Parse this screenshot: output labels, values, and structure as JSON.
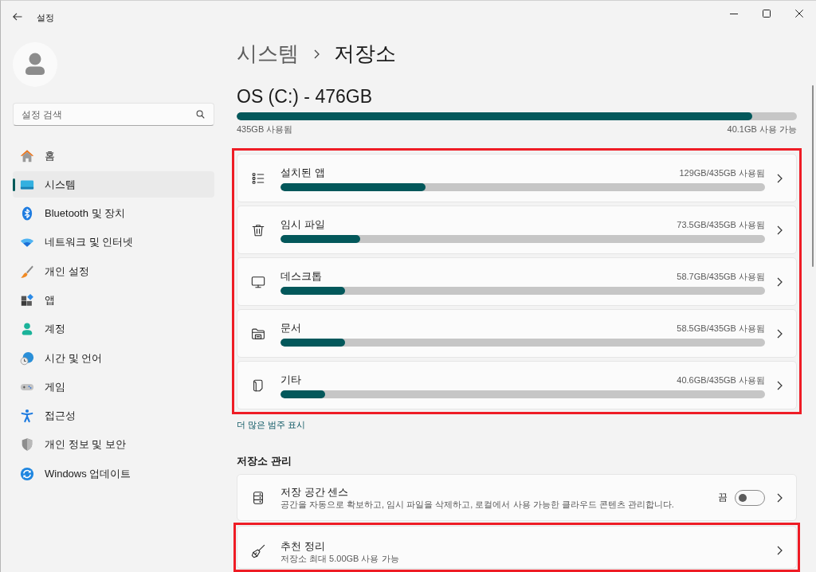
{
  "window": {
    "title": "설정"
  },
  "sidebar": {
    "search": {
      "placeholder": "설정 검색"
    },
    "items": [
      {
        "label": "홈",
        "selected": false
      },
      {
        "label": "시스템",
        "selected": true
      },
      {
        "label": "Bluetooth 및 장치",
        "selected": false
      },
      {
        "label": "네트워크 및 인터넷",
        "selected": false
      },
      {
        "label": "개인 설정",
        "selected": false
      },
      {
        "label": "앱",
        "selected": false
      },
      {
        "label": "계정",
        "selected": false
      },
      {
        "label": "시간 및 언어",
        "selected": false
      },
      {
        "label": "게임",
        "selected": false
      },
      {
        "label": "접근성",
        "selected": false
      },
      {
        "label": "개인 정보 및 보안",
        "selected": false
      },
      {
        "label": "Windows 업데이트",
        "selected": false
      }
    ]
  },
  "breadcrumb": [
    "시스템",
    "저장소"
  ],
  "drive": {
    "title": "OS (C:) - 476GB",
    "level": 0.92,
    "used": "435GB 사용됨",
    "available": "40.1GB 사용 가능"
  },
  "categories": {
    "highlighted": true,
    "items": [
      {
        "label": "설치된 앱",
        "usage": "129GB/435GB 사용됨",
        "level": 0.3
      },
      {
        "label": "임시 파일",
        "usage": "73.5GB/435GB 사용됨",
        "level": 0.165
      },
      {
        "label": "데스크톱",
        "usage": "58.7GB/435GB 사용됨",
        "level": 0.134
      },
      {
        "label": "문서",
        "usage": "58.5GB/435GB 사용됨",
        "level": 0.134
      },
      {
        "label": "기타",
        "usage": "40.6GB/435GB 사용됨",
        "level": 0.092
      }
    ]
  },
  "more_link": "더 많은 범주 표시",
  "management": {
    "title": "저장소 관리",
    "items": [
      {
        "kind": "toggle",
        "label": "저장 공간 센스",
        "description": "공간을 자동으로 확보하고, 임시 파일을 삭제하고, 로컬에서 사용 가능한 클라우드 콘텐츠 관리합니다.",
        "state_label": "끔",
        "on": false,
        "highlighted": false
      },
      {
        "kind": "link",
        "label": "추천 정리",
        "description": "저장소 최대 5.00GB 사용 가능",
        "highlighted": true
      }
    ]
  }
}
